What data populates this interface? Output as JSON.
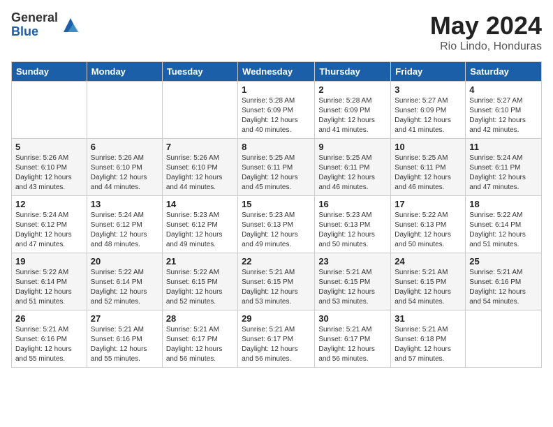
{
  "header": {
    "logo_general": "General",
    "logo_blue": "Blue",
    "title": "May 2024",
    "location": "Rio Lindo, Honduras"
  },
  "days_of_week": [
    "Sunday",
    "Monday",
    "Tuesday",
    "Wednesday",
    "Thursday",
    "Friday",
    "Saturday"
  ],
  "weeks": [
    [
      {
        "day": "",
        "info": ""
      },
      {
        "day": "",
        "info": ""
      },
      {
        "day": "",
        "info": ""
      },
      {
        "day": "1",
        "info": "Sunrise: 5:28 AM\nSunset: 6:09 PM\nDaylight: 12 hours\nand 40 minutes."
      },
      {
        "day": "2",
        "info": "Sunrise: 5:28 AM\nSunset: 6:09 PM\nDaylight: 12 hours\nand 41 minutes."
      },
      {
        "day": "3",
        "info": "Sunrise: 5:27 AM\nSunset: 6:09 PM\nDaylight: 12 hours\nand 41 minutes."
      },
      {
        "day": "4",
        "info": "Sunrise: 5:27 AM\nSunset: 6:10 PM\nDaylight: 12 hours\nand 42 minutes."
      }
    ],
    [
      {
        "day": "5",
        "info": "Sunrise: 5:26 AM\nSunset: 6:10 PM\nDaylight: 12 hours\nand 43 minutes."
      },
      {
        "day": "6",
        "info": "Sunrise: 5:26 AM\nSunset: 6:10 PM\nDaylight: 12 hours\nand 44 minutes."
      },
      {
        "day": "7",
        "info": "Sunrise: 5:26 AM\nSunset: 6:10 PM\nDaylight: 12 hours\nand 44 minutes."
      },
      {
        "day": "8",
        "info": "Sunrise: 5:25 AM\nSunset: 6:11 PM\nDaylight: 12 hours\nand 45 minutes."
      },
      {
        "day": "9",
        "info": "Sunrise: 5:25 AM\nSunset: 6:11 PM\nDaylight: 12 hours\nand 46 minutes."
      },
      {
        "day": "10",
        "info": "Sunrise: 5:25 AM\nSunset: 6:11 PM\nDaylight: 12 hours\nand 46 minutes."
      },
      {
        "day": "11",
        "info": "Sunrise: 5:24 AM\nSunset: 6:11 PM\nDaylight: 12 hours\nand 47 minutes."
      }
    ],
    [
      {
        "day": "12",
        "info": "Sunrise: 5:24 AM\nSunset: 6:12 PM\nDaylight: 12 hours\nand 47 minutes."
      },
      {
        "day": "13",
        "info": "Sunrise: 5:24 AM\nSunset: 6:12 PM\nDaylight: 12 hours\nand 48 minutes."
      },
      {
        "day": "14",
        "info": "Sunrise: 5:23 AM\nSunset: 6:12 PM\nDaylight: 12 hours\nand 49 minutes."
      },
      {
        "day": "15",
        "info": "Sunrise: 5:23 AM\nSunset: 6:13 PM\nDaylight: 12 hours\nand 49 minutes."
      },
      {
        "day": "16",
        "info": "Sunrise: 5:23 AM\nSunset: 6:13 PM\nDaylight: 12 hours\nand 50 minutes."
      },
      {
        "day": "17",
        "info": "Sunrise: 5:22 AM\nSunset: 6:13 PM\nDaylight: 12 hours\nand 50 minutes."
      },
      {
        "day": "18",
        "info": "Sunrise: 5:22 AM\nSunset: 6:14 PM\nDaylight: 12 hours\nand 51 minutes."
      }
    ],
    [
      {
        "day": "19",
        "info": "Sunrise: 5:22 AM\nSunset: 6:14 PM\nDaylight: 12 hours\nand 51 minutes."
      },
      {
        "day": "20",
        "info": "Sunrise: 5:22 AM\nSunset: 6:14 PM\nDaylight: 12 hours\nand 52 minutes."
      },
      {
        "day": "21",
        "info": "Sunrise: 5:22 AM\nSunset: 6:15 PM\nDaylight: 12 hours\nand 52 minutes."
      },
      {
        "day": "22",
        "info": "Sunrise: 5:21 AM\nSunset: 6:15 PM\nDaylight: 12 hours\nand 53 minutes."
      },
      {
        "day": "23",
        "info": "Sunrise: 5:21 AM\nSunset: 6:15 PM\nDaylight: 12 hours\nand 53 minutes."
      },
      {
        "day": "24",
        "info": "Sunrise: 5:21 AM\nSunset: 6:15 PM\nDaylight: 12 hours\nand 54 minutes."
      },
      {
        "day": "25",
        "info": "Sunrise: 5:21 AM\nSunset: 6:16 PM\nDaylight: 12 hours\nand 54 minutes."
      }
    ],
    [
      {
        "day": "26",
        "info": "Sunrise: 5:21 AM\nSunset: 6:16 PM\nDaylight: 12 hours\nand 55 minutes."
      },
      {
        "day": "27",
        "info": "Sunrise: 5:21 AM\nSunset: 6:16 PM\nDaylight: 12 hours\nand 55 minutes."
      },
      {
        "day": "28",
        "info": "Sunrise: 5:21 AM\nSunset: 6:17 PM\nDaylight: 12 hours\nand 56 minutes."
      },
      {
        "day": "29",
        "info": "Sunrise: 5:21 AM\nSunset: 6:17 PM\nDaylight: 12 hours\nand 56 minutes."
      },
      {
        "day": "30",
        "info": "Sunrise: 5:21 AM\nSunset: 6:17 PM\nDaylight: 12 hours\nand 56 minutes."
      },
      {
        "day": "31",
        "info": "Sunrise: 5:21 AM\nSunset: 6:18 PM\nDaylight: 12 hours\nand 57 minutes."
      },
      {
        "day": "",
        "info": ""
      }
    ]
  ]
}
